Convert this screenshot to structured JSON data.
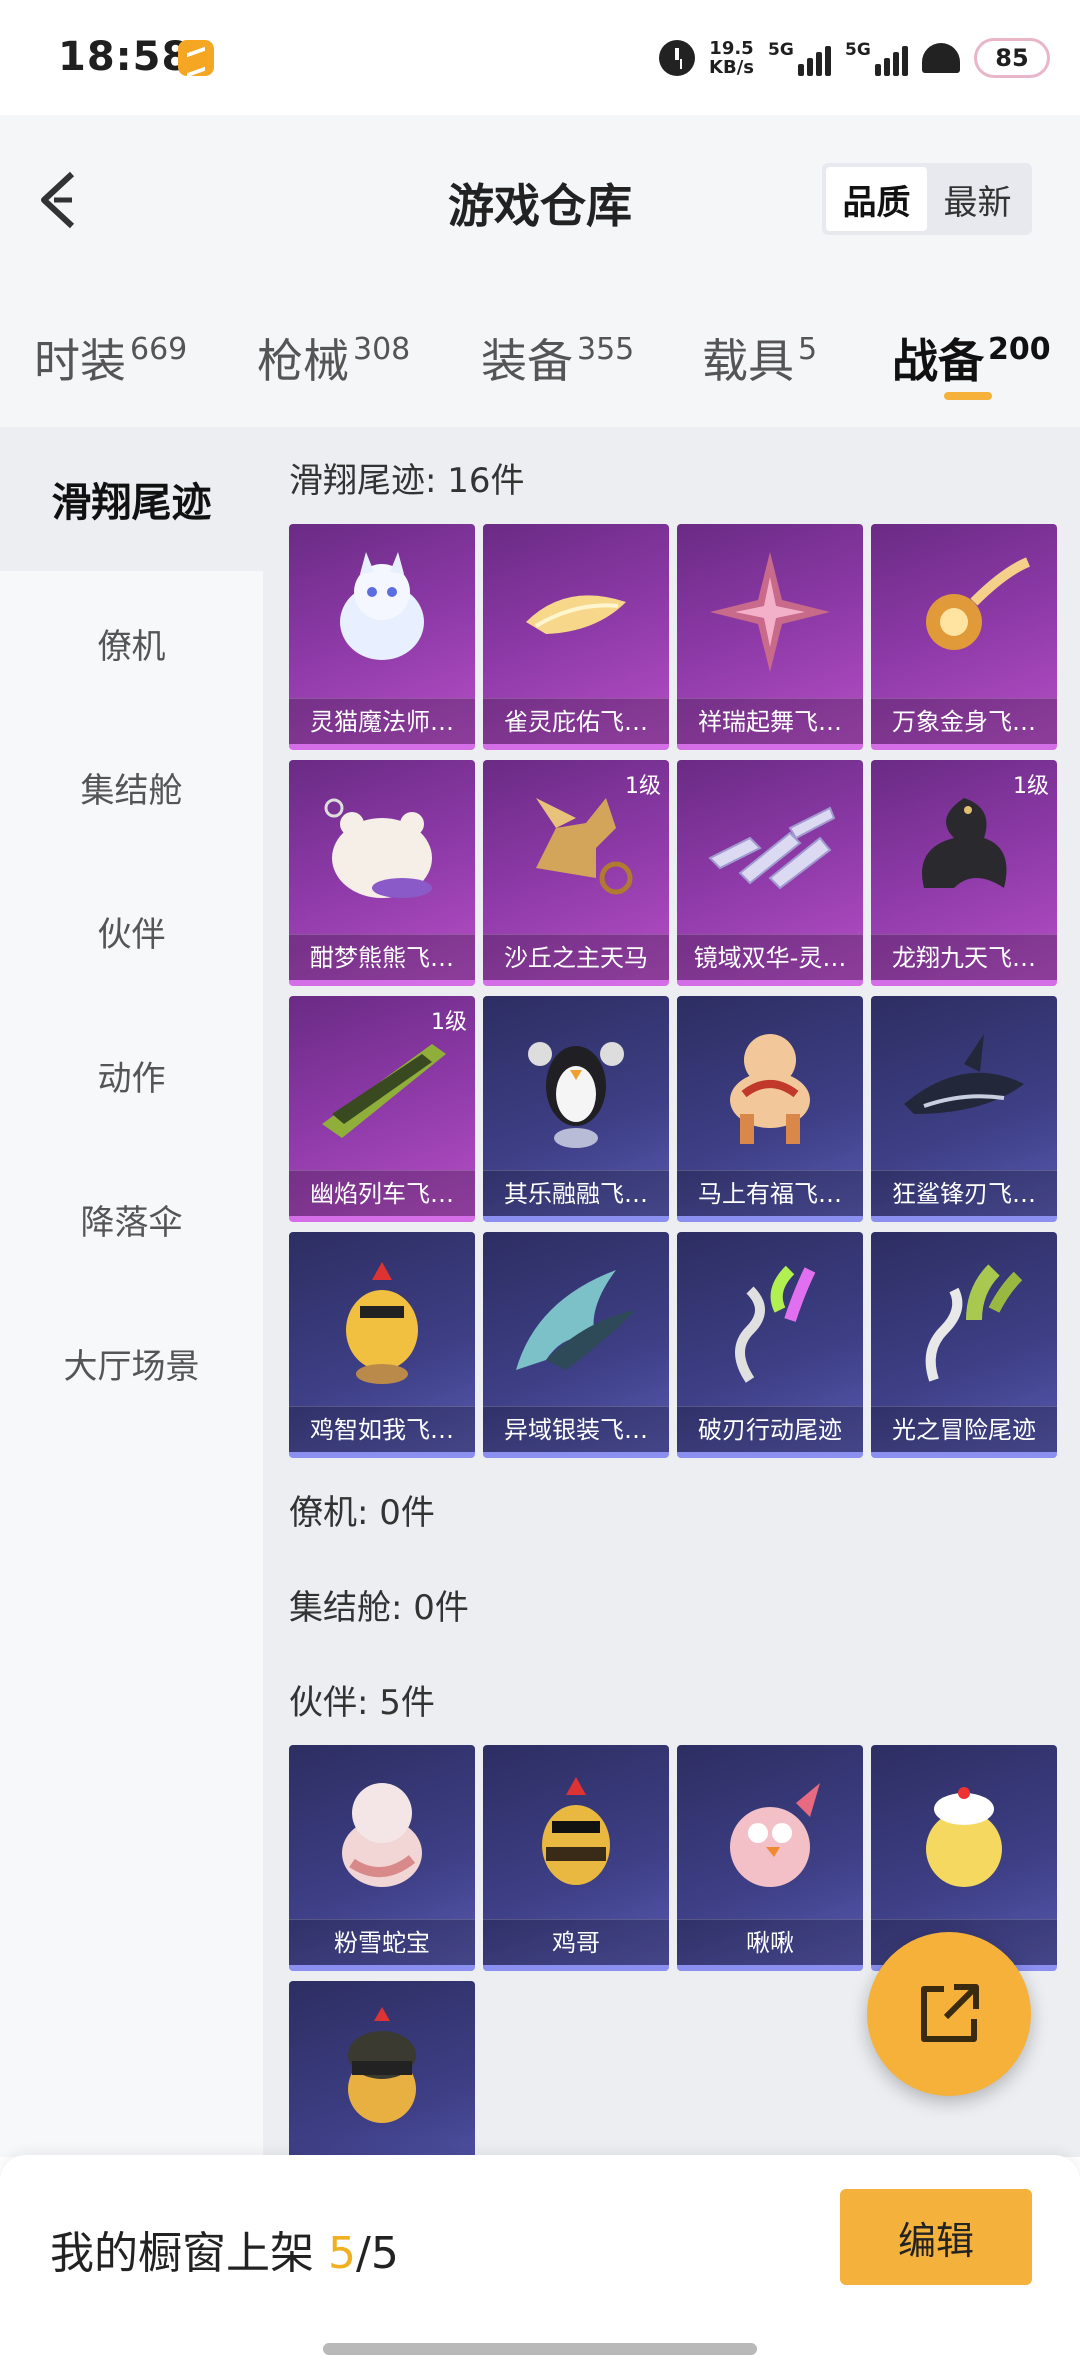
{
  "status": {
    "time": "18:58",
    "speed_value": "19.5",
    "speed_unit": "KB/s",
    "sig1": "5G",
    "sig2": "5G",
    "battery": "85"
  },
  "header": {
    "title": "游戏仓库",
    "sort_quality": "品质",
    "sort_latest": "最新"
  },
  "tabs": [
    {
      "label": "时装",
      "count": "669"
    },
    {
      "label": "枪械",
      "count": "308"
    },
    {
      "label": "装备",
      "count": "355"
    },
    {
      "label": "载具",
      "count": "5"
    },
    {
      "label": "战备",
      "count": "200"
    }
  ],
  "sidebar": [
    "滑翔尾迹",
    "僚机",
    "集结舱",
    "伙伴",
    "动作",
    "降落伞",
    "大厅场景"
  ],
  "sections": {
    "glide": {
      "title": "滑翔尾迹: 16件",
      "items": [
        {
          "name": "灵猫魔法师…",
          "level": ""
        },
        {
          "name": "雀灵庇佑飞…",
          "level": ""
        },
        {
          "name": "祥瑞起舞飞…",
          "level": ""
        },
        {
          "name": "万象金身飞…",
          "level": ""
        },
        {
          "name": "酣梦熊熊飞…",
          "level": ""
        },
        {
          "name": "沙丘之主天马",
          "level": "1级"
        },
        {
          "name": "镜域双华-灵…",
          "level": ""
        },
        {
          "name": "龙翔九天飞…",
          "level": "1级"
        },
        {
          "name": "幽焰列车飞…",
          "level": "1级"
        },
        {
          "name": "其乐融融飞…",
          "level": ""
        },
        {
          "name": "马上有福飞…",
          "level": ""
        },
        {
          "name": "狂鲨锋刃飞…",
          "level": ""
        },
        {
          "name": "鸡智如我飞…",
          "level": ""
        },
        {
          "name": "异域银装飞…",
          "level": ""
        },
        {
          "name": "破刃行动尾迹",
          "level": ""
        },
        {
          "name": "光之冒险尾迹",
          "level": ""
        }
      ]
    },
    "wingman": {
      "title": "僚机: 0件"
    },
    "capsule": {
      "title": "集结舱: 0件"
    },
    "partner": {
      "title": "伙伴: 5件",
      "items": [
        {
          "name": "粉雪蛇宝"
        },
        {
          "name": "鸡哥"
        },
        {
          "name": "啾啾"
        },
        {
          "name": "…"
        },
        {
          "name": ""
        }
      ]
    }
  },
  "bottom": {
    "showcase_label": "我的橱窗上架",
    "showcase_current": "5",
    "showcase_sep": "/",
    "showcase_total": "5",
    "edit": "编辑"
  }
}
